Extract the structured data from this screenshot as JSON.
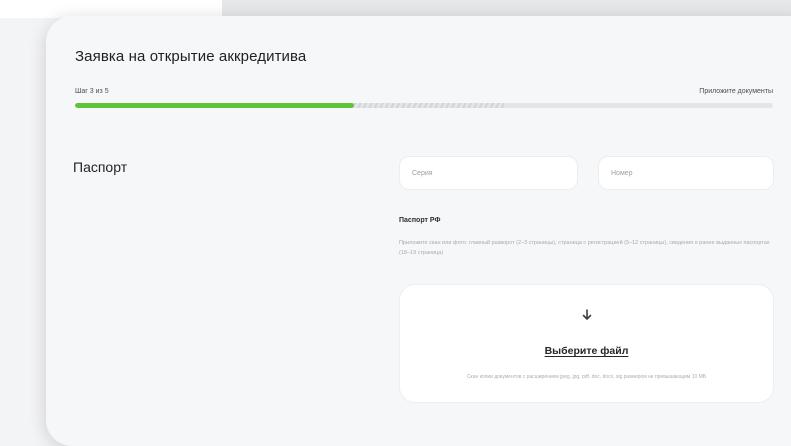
{
  "form": {
    "title": "Заявка на открытие аккредитива",
    "step_counter": "Шаг 3 из 5",
    "step_name": "Приложите документы",
    "progress_fraction": 0.4
  },
  "passport": {
    "section_title": "Паспорт",
    "series_placeholder": "Серия",
    "number_placeholder": "Номер",
    "doc_label": "Паспорт РФ",
    "doc_hint": "Приложите скан или фото: главный разворот (2–3 страницы), страница с регистрацией (5–12 страницы), сведения о ранее выданных паспортах (18–19 страница)",
    "upload_link": "Выберите файл",
    "upload_note": "Скан копии документов с расширением jpeg, jpg, pdf, doc, docx, sig размером не превышающим 10 МБ"
  },
  "colors": {
    "accent": "#62c23a"
  },
  "icons": {
    "upload": "arrow-down-icon"
  }
}
